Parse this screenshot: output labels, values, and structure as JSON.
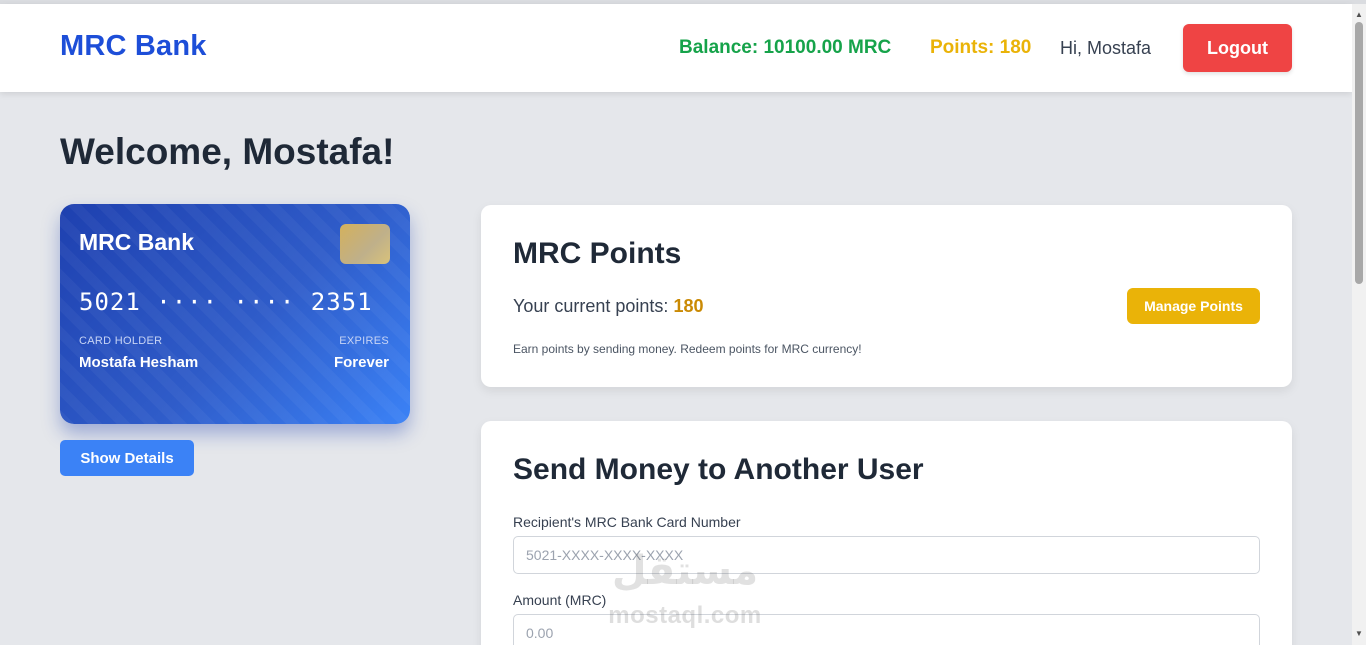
{
  "header": {
    "brand": "MRC Bank",
    "balance": "Balance: 10100.00 MRC",
    "points": "Points: 180",
    "greeting": "Hi, Mostafa",
    "logout_label": "Logout"
  },
  "welcome": "Welcome, Mostafa!",
  "card": {
    "bank_name": "MRC Bank",
    "number": "5021 ···· ···· 2351",
    "holder_label": "CARD HOLDER",
    "holder": "Mostafa Hesham",
    "expires_label": "EXPIRES",
    "expires": "Forever",
    "show_details_label": "Show Details"
  },
  "points_panel": {
    "title": "MRC Points",
    "current_label": "Your current points: ",
    "current_value": "180",
    "manage_label": "Manage Points",
    "note": "Earn points by sending money. Redeem points for MRC currency!"
  },
  "send_panel": {
    "title": "Send Money to Another User",
    "card_label": "Recipient's MRC Bank Card Number",
    "card_placeholder": "5021-XXXX-XXXX-XXXX",
    "amount_label": "Amount (MRC)",
    "amount_placeholder": "0.00"
  },
  "watermark": {
    "arabic": "مستقل",
    "latin": "mostaql.com"
  },
  "colors": {
    "brand": "#1d4ed8",
    "balance": "#16a34a",
    "points": "#eab308",
    "logout": "#ef4444",
    "primary_button": "#3b82f6",
    "background": "#e5e7eb"
  },
  "icons": [
    "card-chip-icon",
    "scroll-up-arrow-icon",
    "scroll-down-arrow-icon"
  ]
}
